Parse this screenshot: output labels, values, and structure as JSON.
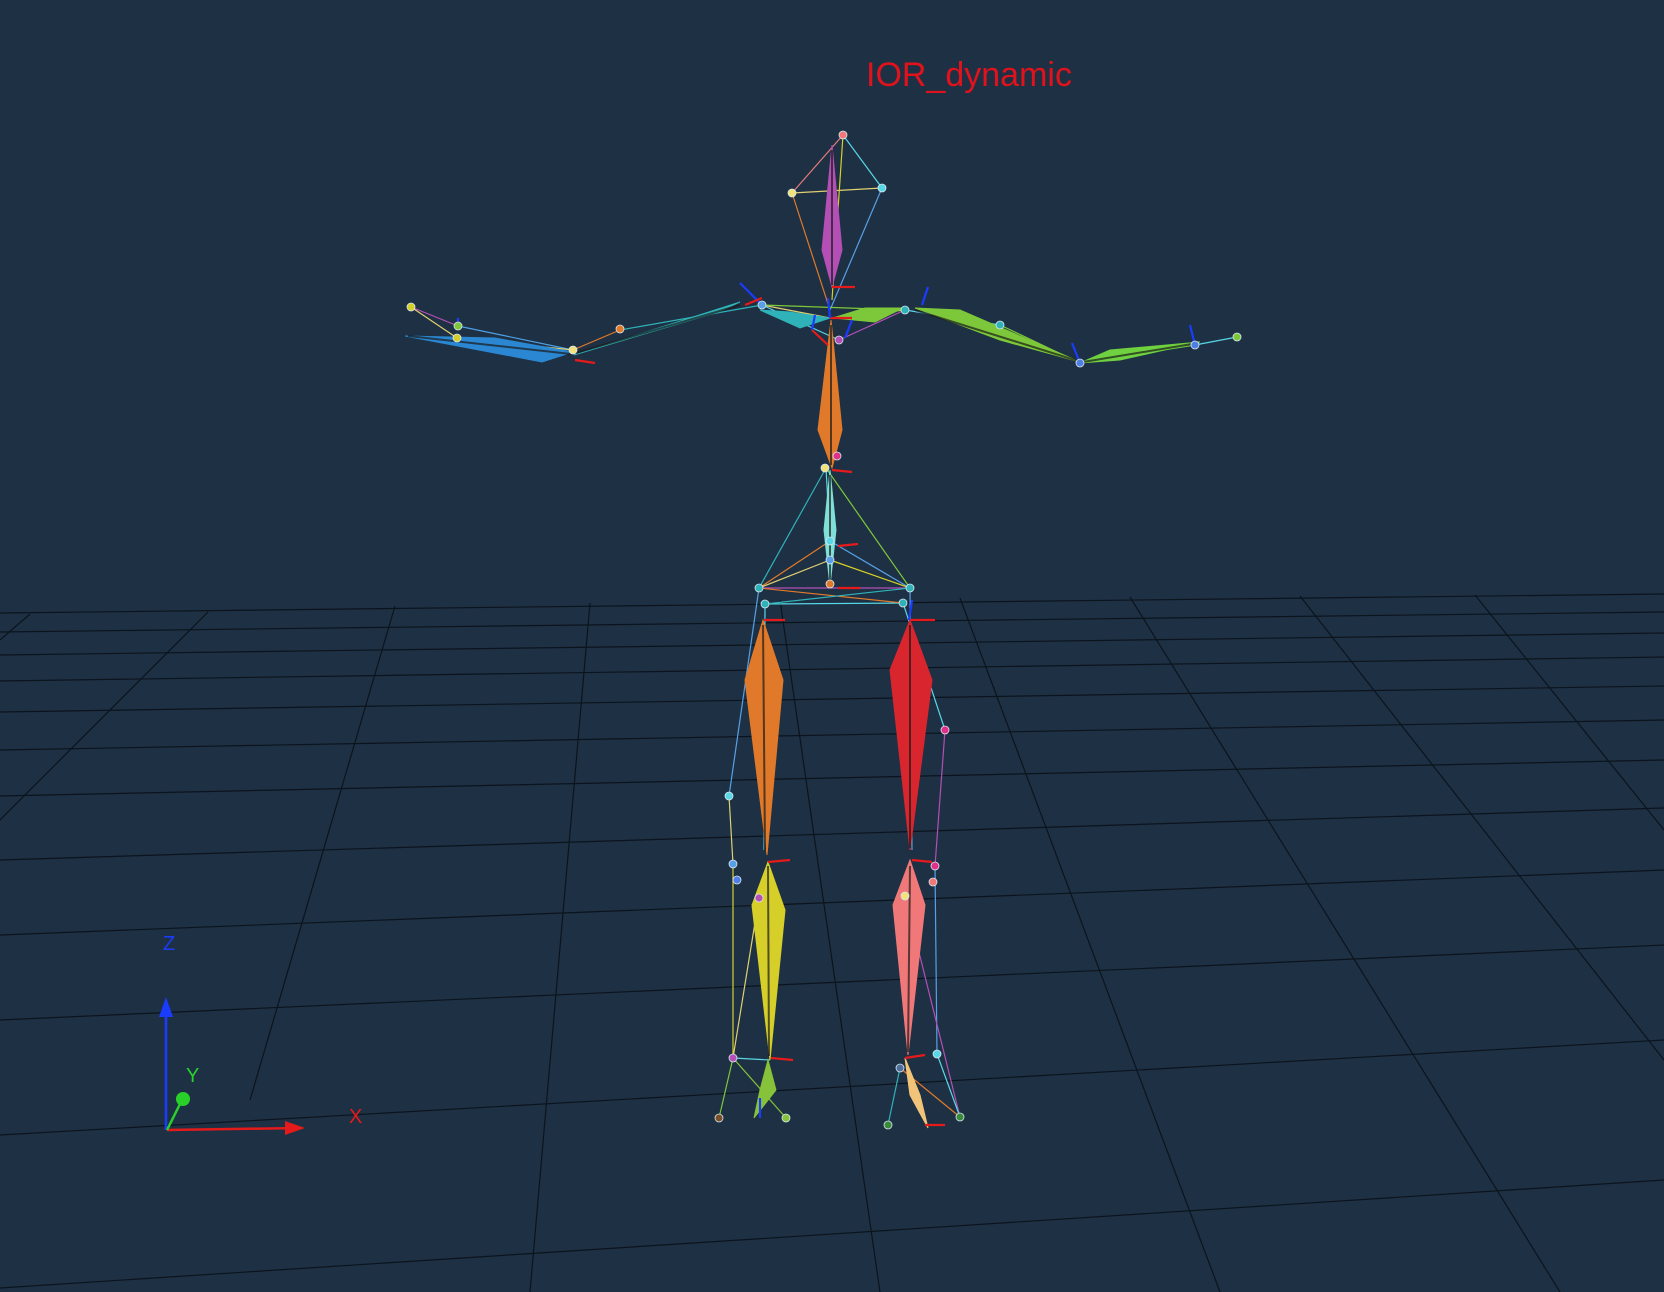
{
  "viewer": {
    "title": "IOR_dynamic",
    "background": "#1e3044",
    "grid_color": "#0b141d"
  },
  "axes": {
    "x_label": "X",
    "y_label": "Y",
    "z_label": "Z",
    "x_color": "#e51a1a",
    "y_color": "#2ad02a",
    "z_color": "#1a3cff"
  },
  "skeleton": {
    "segment_colors": {
      "head": "#b34fb5",
      "torso": "#e07a2a",
      "pelvis": "#7fe0d8",
      "right_upper_arm": "#2fb3b8",
      "right_forearm": "#2b87d1",
      "left_upper_arm": "#7dc83a",
      "left_forearm": "#6fd040",
      "right_thigh": "#e07a2a",
      "left_thigh": "#d9262e",
      "right_shank": "#d6cf2a",
      "left_shank": "#f07878",
      "right_foot": "#86c23a",
      "left_foot": "#f2c47a"
    }
  }
}
